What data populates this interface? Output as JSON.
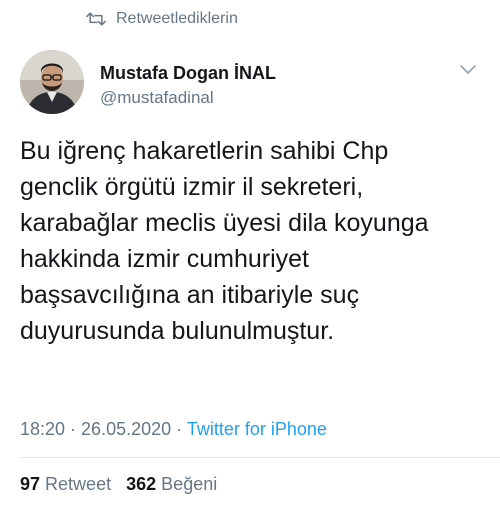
{
  "retweet_header": {
    "icon": "retweet-icon",
    "label": "Retweetlediklerin"
  },
  "author": {
    "name": "Mustafa Dogan İNAL",
    "handle": "@mustafadinal"
  },
  "tweet": {
    "lines": [
      "Bu iğrenç hakaretlerin sahibi Chp",
      "genclik örgütü izmir il sekreteri,",
      "karabağlar meclis üyesi dila koyunga",
      "hakkinda izmir cumhuriyet",
      "başsavcılığına an itibariyle suç",
      "duyurusunda bulunulmuştur."
    ],
    "time": "18:20",
    "date": "26.05.2020",
    "separator": " · ",
    "source": "Twitter for iPhone"
  },
  "stats": {
    "retweet_count": "97",
    "retweet_label": "Retweet",
    "like_count": "362",
    "like_label": "Beğeni"
  },
  "colors": {
    "secondary": "#657786",
    "link": "#1da1f2",
    "text": "#14171a"
  }
}
